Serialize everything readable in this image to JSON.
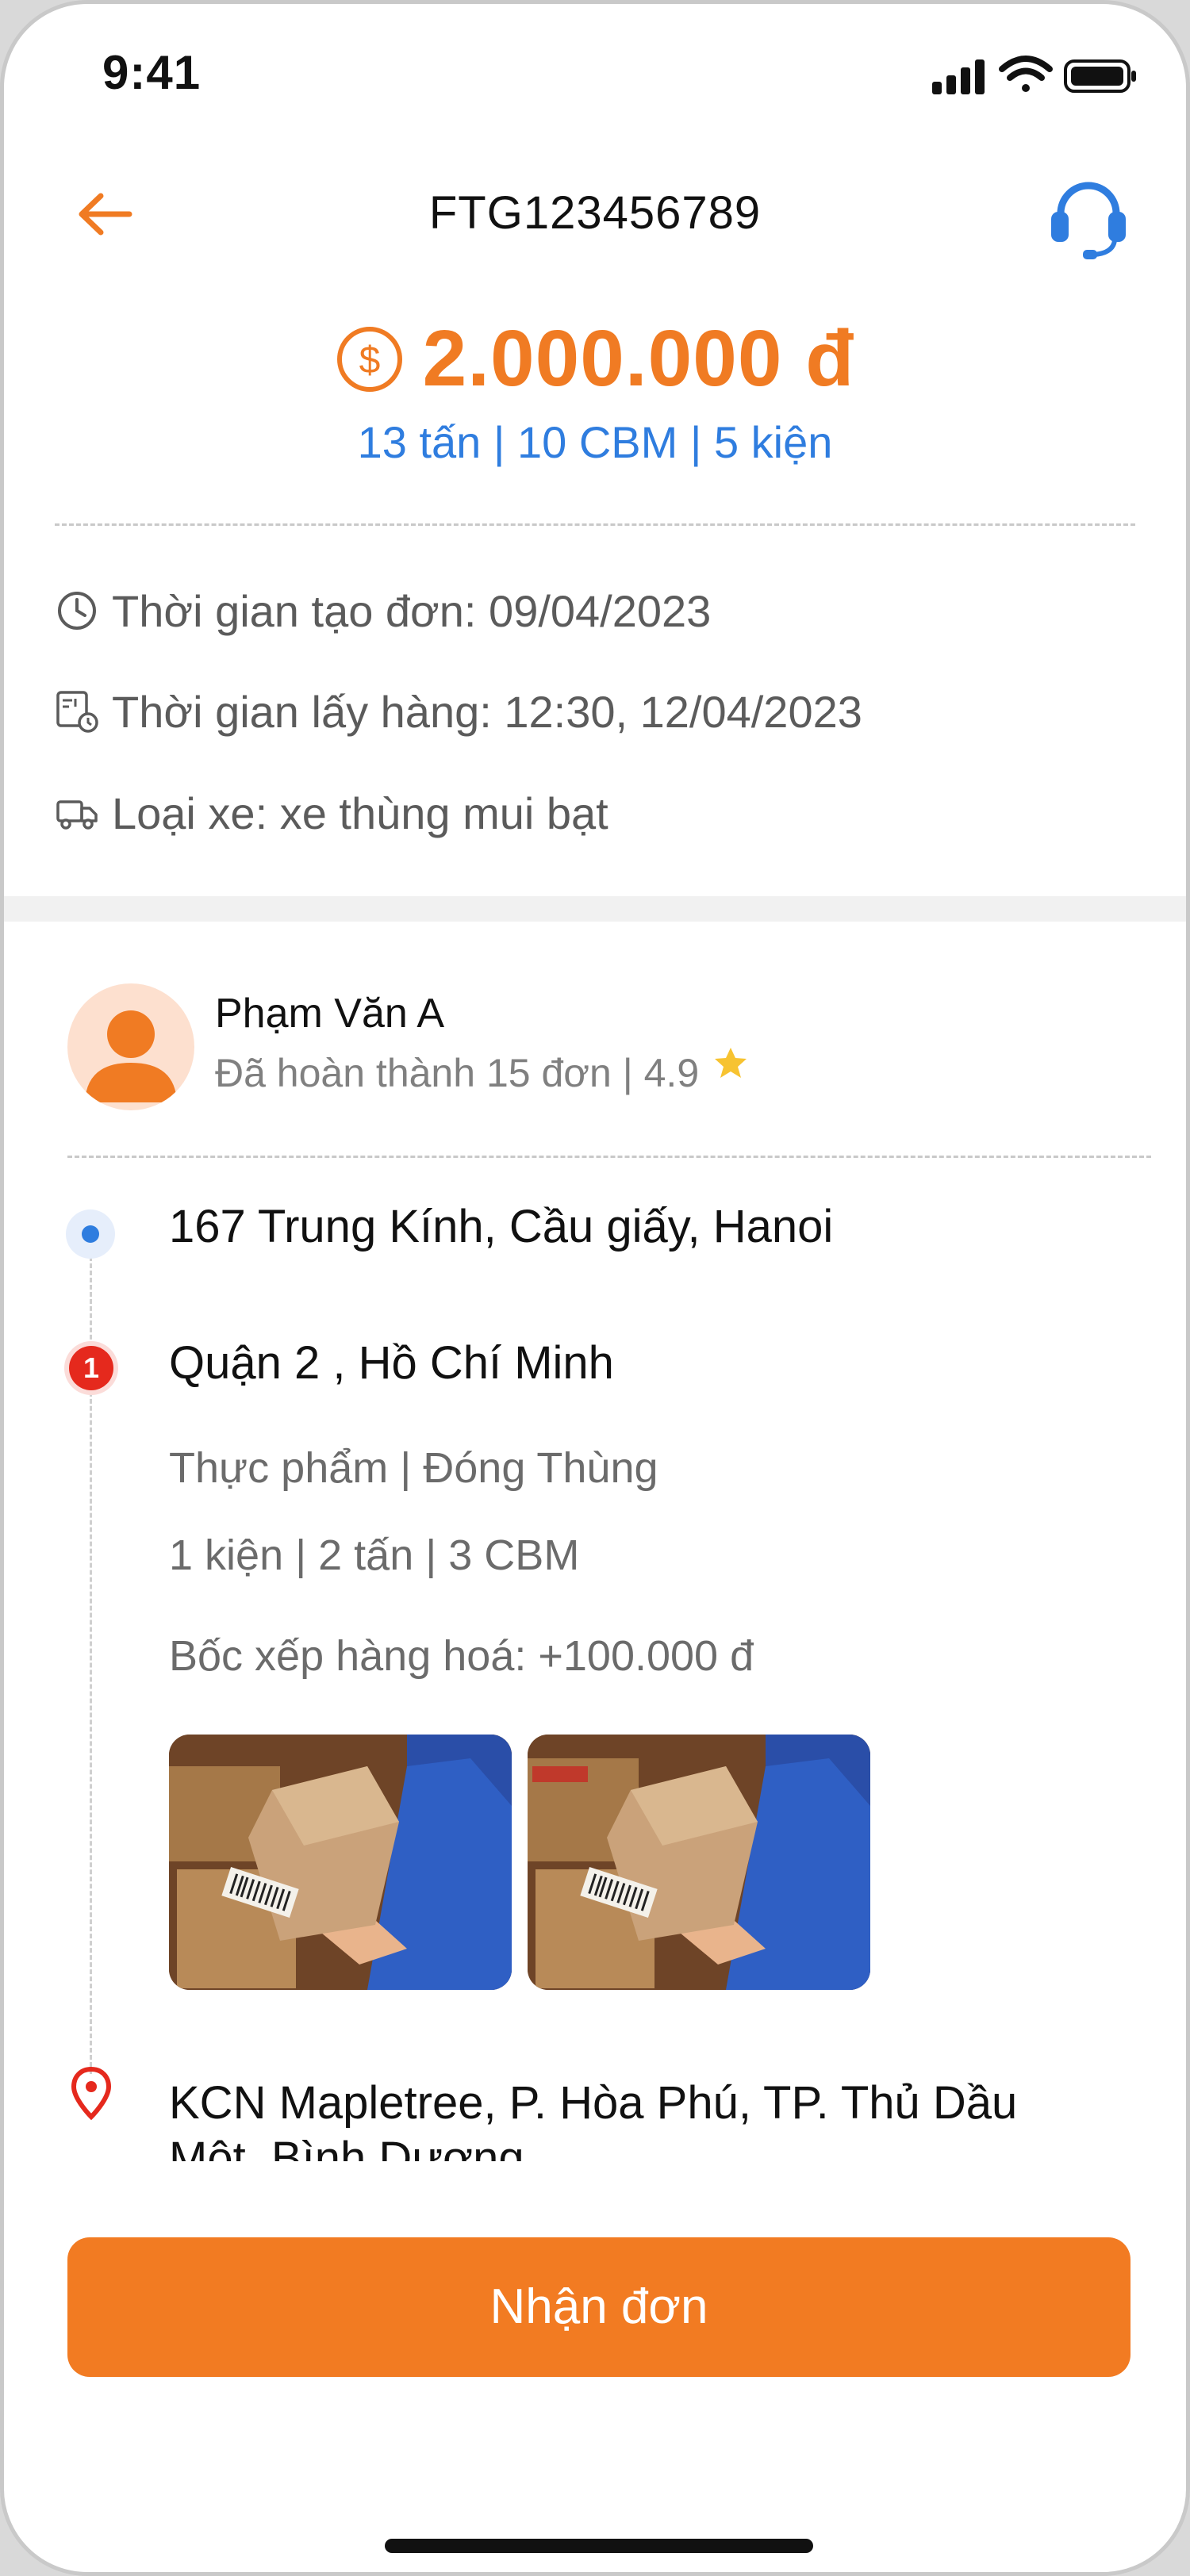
{
  "status": {
    "time": "9:41"
  },
  "header": {
    "order_id": "FTG123456789"
  },
  "summary": {
    "price": "2.000.000 đ",
    "specs": "13 tấn | 10 CBM | 5 kiện"
  },
  "info": {
    "created": "Thời gian tạo đơn: 09/04/2023",
    "pickup": "Thời gian lấy hàng: 12:30, 12/04/2023",
    "vehicle": "Loại xe: xe thùng mui bạt"
  },
  "driver": {
    "name": "Phạm Văn A",
    "stats": "Đã hoàn thành 15 đơn | 4.9"
  },
  "route": {
    "origin": "167 Trung Kính, Cầu giấy, Hanoi",
    "stop1": {
      "index": "1",
      "address": "Quận 2 , Hồ Chí Minh",
      "category": "Thực phẩm | Đóng Thùng",
      "load": "1 kiện | 2 tấn | 3 CBM",
      "handling": "Bốc xếp hàng hoá: +100.000 đ"
    },
    "destination": "KCN Mapletree, P. Hòa Phú, TP. Thủ Dầu Một, Bình Dương"
  },
  "actions": {
    "accept_label": "Nhận đơn"
  },
  "colors": {
    "accent": "#f27b22",
    "blue": "#2f7ddf",
    "red": "#e5291d"
  },
  "icons": [
    "arrow-left-icon",
    "headset-icon",
    "dollar-icon",
    "clock-icon",
    "calendar-box-icon",
    "truck-icon",
    "star-icon",
    "location-pin-icon"
  ]
}
